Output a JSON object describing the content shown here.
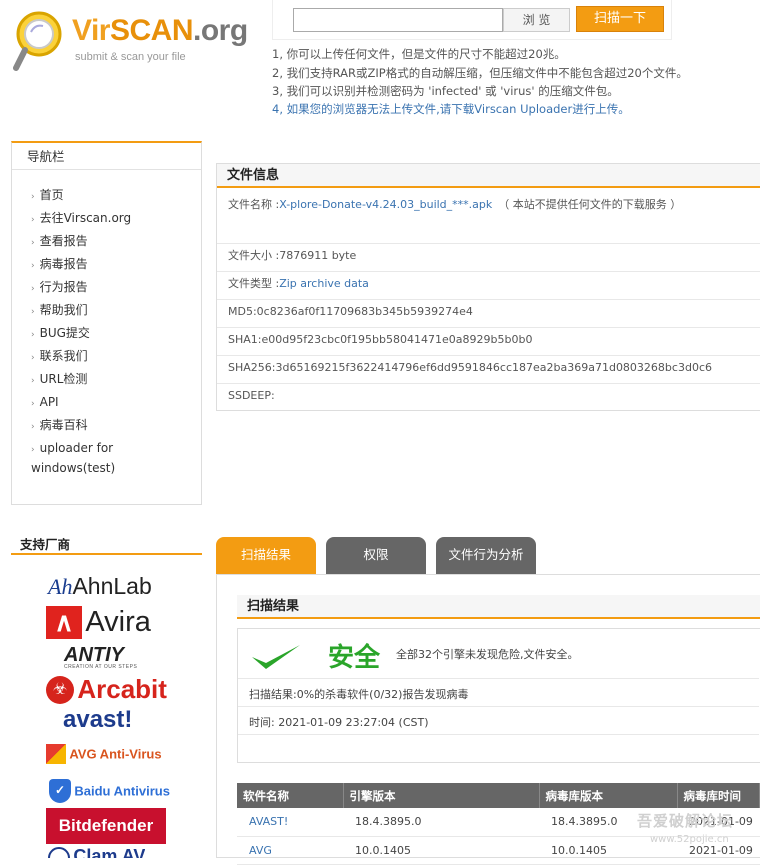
{
  "header": {
    "logo_title_vir": "Vir",
    "logo_title_scan": "SCAN",
    "logo_title_org": ".org",
    "logo_subtitle": "submit & scan your file",
    "browse_label": "浏 览",
    "scan_label": "扫描一下",
    "notes": [
      "1, 你可以上传任何文件，但是文件的尺寸不能超过20兆。",
      "2, 我们支持RAR或ZIP格式的自动解压缩，但压缩文件中不能包含超过20个文件。",
      "3, 我们可以识别并检测密码为 'infected' 或 'virus' 的压缩文件包。",
      "4, 如果您的浏览器无法上传文件,请下载Virscan Uploader进行上传。"
    ]
  },
  "nav": {
    "title": "导航栏",
    "items": [
      "首页",
      "去往Virscan.org",
      "查看报告",
      "病毒报告",
      "行为报告",
      "帮助我们",
      "BUG提交",
      "联系我们",
      "URL检测",
      "API",
      "病毒百科",
      "uploader for windows(test)"
    ]
  },
  "vendors": {
    "title": "支持厂商",
    "list": [
      "AhnLab",
      "Avira",
      "ANTIY",
      "Arcabit",
      "avast!",
      "AVG Anti-Virus",
      "Baidu Antivirus",
      "Bitdefender",
      "Clam AV"
    ],
    "antiy_tagline": "CREATION AT OUR STEPS"
  },
  "file_info": {
    "title": "文件信息",
    "name_label": "文件名称 :",
    "name_value": "X-plore-Donate-v4.24.03_build_***.apk",
    "name_note": "（ 本站不提供任何文件的下载服务 ）",
    "size": "文件大小 :7876911 byte",
    "type_label": "文件类型 :",
    "type_value": "Zip archive data",
    "md5": "MD5:0c8236af0f11709683b345b5939274e4",
    "sha1": "SHA1:e00d95f23cbc0f195bb58041471e0a8929b5b0b0",
    "sha256": "SHA256:3d65169215f3622414796ef6dd9591846cc187ea2ba369a71d0803268bc3d0c6",
    "ssdeep": "SSDEEP:"
  },
  "tabs": [
    "扫描结果",
    "权限",
    "文件行为分析"
  ],
  "scan_result": {
    "title": "扫描结果",
    "safe_label": "安全",
    "safe_message": "全部32个引擎未发现危险,文件安全。",
    "summary": "扫描结果:0%的杀毒软件(0/32)报告发现病毒",
    "time": "时间: 2021-01-09 23:27:04 (CST)"
  },
  "results_table": {
    "headers": [
      "软件名称",
      "引擎版本",
      "病毒库版本",
      "病毒库时间"
    ],
    "rows": [
      [
        "AVAST!",
        "18.4.3895.0",
        "18.4.3895.0",
        "2021-01-09"
      ],
      [
        "AVG",
        "10.0.1405",
        "10.0.1405",
        "2021-01-09"
      ]
    ]
  },
  "watermark": {
    "line1": "吾爱破解论坛",
    "line2": "www.52pojie.cn"
  },
  "colors": {
    "accent": "#f39c12",
    "safe": "#2aa52a",
    "link": "#3a73b0",
    "tab_inactive": "#666666"
  }
}
